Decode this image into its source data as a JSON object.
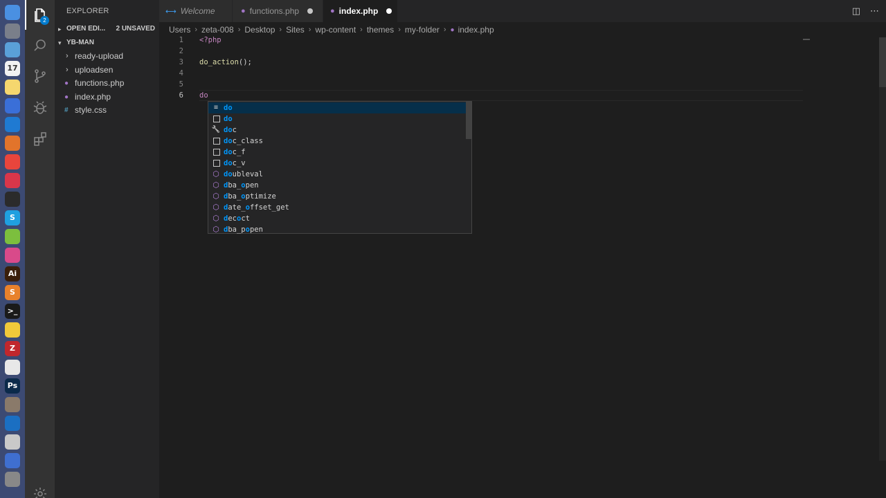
{
  "dock": {
    "apps": [
      {
        "name": "finder-icon",
        "color": "#4a90e2",
        "glyph": ""
      },
      {
        "name": "launchpad-icon",
        "color": "#7a7f8a",
        "glyph": ""
      },
      {
        "name": "preview-icon",
        "color": "#5aa0d8",
        "glyph": ""
      },
      {
        "name": "calendar-icon",
        "color": "#f2f2f2",
        "glyph": "17"
      },
      {
        "name": "notes-icon",
        "color": "#f5d76e",
        "glyph": ""
      },
      {
        "name": "pen-tool-icon",
        "color": "#3a6fd8",
        "glyph": ""
      },
      {
        "name": "vscode-icon",
        "color": "#1f7ad2",
        "glyph": ""
      },
      {
        "name": "affinity-icon",
        "color": "#e2742b",
        "glyph": ""
      },
      {
        "name": "chrome-icon",
        "color": "#e8453c",
        "glyph": ""
      },
      {
        "name": "red-app-icon",
        "color": "#d9364a",
        "glyph": ""
      },
      {
        "name": "paw-app-icon",
        "color": "#2b2b2b",
        "glyph": ""
      },
      {
        "name": "skype-icon",
        "color": "#1fa0e0",
        "glyph": "S"
      },
      {
        "name": "android-icon",
        "color": "#7cbf3e",
        "glyph": ""
      },
      {
        "name": "music-icon",
        "color": "#d94a8a",
        "glyph": ""
      },
      {
        "name": "illustrator-icon",
        "color": "#3a1f0b",
        "glyph": "Ai"
      },
      {
        "name": "sublime-icon",
        "color": "#e8812b",
        "glyph": "S"
      },
      {
        "name": "terminal-icon",
        "color": "#1a1a1a",
        "glyph": ">_"
      },
      {
        "name": "cyberduck-icon",
        "color": "#f0c93a",
        "glyph": ""
      },
      {
        "name": "filezilla-icon",
        "color": "#c1272d",
        "glyph": "Z"
      },
      {
        "name": "textedit-icon",
        "color": "#e8e8e8",
        "glyph": ""
      },
      {
        "name": "photoshop-icon",
        "color": "#0b2a4a",
        "glyph": "Ps"
      },
      {
        "name": "automator-icon",
        "color": "#8a7a6a",
        "glyph": ""
      },
      {
        "name": "quicktime-icon",
        "color": "#1b6fc2",
        "glyph": ""
      },
      {
        "name": "script-icon",
        "color": "#c9c9c9",
        "glyph": ""
      },
      {
        "name": "flag-app-icon",
        "color": "#3f6fd0",
        "glyph": ""
      },
      {
        "name": "system-app-icon",
        "color": "#888888",
        "glyph": ""
      }
    ]
  },
  "activity_bar": {
    "explorer_badge": "2"
  },
  "sidebar": {
    "title": "EXPLORER",
    "open_editors": {
      "label": "OPEN EDI...",
      "unsaved": "2 UNSAVED"
    },
    "project": {
      "label": "YB-MAN"
    },
    "items": [
      {
        "label": "ready-upload",
        "type": "folder"
      },
      {
        "label": "uploadsen",
        "type": "folder"
      },
      {
        "label": "functions.php",
        "type": "php"
      },
      {
        "label": "index.php",
        "type": "php"
      },
      {
        "label": "style.css",
        "type": "css"
      }
    ]
  },
  "tabs": [
    {
      "label": "Welcome",
      "italic": true
    },
    {
      "label": "functions.php",
      "dirty": true
    },
    {
      "label": "index.php",
      "dirty": true,
      "active": true
    }
  ],
  "breadcrumb": [
    "Users",
    "zeta-008",
    "Desktop",
    "Sites",
    "wp-content",
    "themes",
    "my-folder",
    "index.php"
  ],
  "editor": {
    "line_numbers": [
      "1",
      "2",
      "3",
      "4",
      "5",
      "6"
    ],
    "line1": "<?php",
    "line3_fn": "do_action",
    "line3_rest": "();",
    "line6": "do"
  },
  "suggestions": [
    {
      "match": "do",
      "rest": "",
      "kind": "snippet"
    },
    {
      "match": "do",
      "rest": "",
      "kind": "keyword"
    },
    {
      "match": "do",
      "rest": "c",
      "kind": "wrench"
    },
    {
      "match": "do",
      "rest": "c_class",
      "kind": "keyword"
    },
    {
      "match": "do",
      "rest": "c_f",
      "kind": "keyword"
    },
    {
      "match": "do",
      "rest": "c_v",
      "kind": "keyword"
    },
    {
      "match": "do",
      "rest": "ubleval",
      "kind": "method"
    },
    {
      "parts": [
        "d",
        "ba_",
        "o",
        "pen"
      ],
      "kind": "method"
    },
    {
      "parts": [
        "d",
        "ba_",
        "o",
        "ptimize"
      ],
      "kind": "method"
    },
    {
      "parts": [
        "d",
        "ate_",
        "o",
        "ffset_get"
      ],
      "kind": "method"
    },
    {
      "parts": [
        "d",
        "ec",
        "o",
        "ct"
      ],
      "kind": "method"
    },
    {
      "parts": [
        "d",
        "ba_p",
        "o",
        "pen"
      ],
      "kind": "method"
    }
  ]
}
